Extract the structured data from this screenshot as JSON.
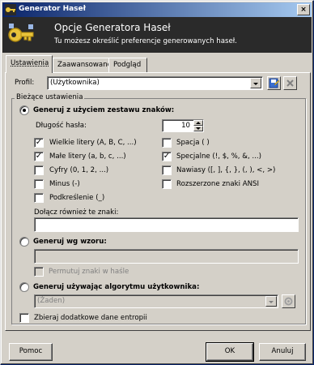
{
  "window": {
    "title": "Generator Haseł",
    "close_glyph": "×"
  },
  "header": {
    "title": "Opcje Generatora Haseł",
    "subtitle": "Tu możesz określić preferencje generowanych haseł.",
    "icon": "key-icon"
  },
  "tabs": [
    {
      "label": "Ustawienia",
      "active": true
    },
    {
      "label": "Zaawansowane",
      "active": false
    },
    {
      "label": "Podgląd",
      "active": false
    }
  ],
  "profile": {
    "label": "Profil:",
    "value": "(Użytkownika)"
  },
  "current_settings": {
    "group_label": "Bieżące ustawienia",
    "charset_mode": {
      "label": "Generuj z użyciem zestawu znaków:",
      "selected": true
    },
    "length": {
      "label": "Długość hasła:",
      "value": "10"
    },
    "options_left": [
      {
        "label": "Wielkie litery (A, B, C, ...)",
        "checked": true
      },
      {
        "label": "Małe litery (a, b, c, ...)",
        "checked": true
      },
      {
        "label": "Cyfry (0, 1, 2, ...)",
        "checked": false
      },
      {
        "label": "Minus (-)",
        "checked": false
      },
      {
        "label": "Podkreślenie (_)",
        "checked": false
      }
    ],
    "options_right": [
      {
        "label": "Spacja ( )",
        "checked": false
      },
      {
        "label": "Specjalne (!, $, %, &, ...)",
        "checked": true
      },
      {
        "label": "Nawiasy ([, ], {, }, (, ), <, >)",
        "checked": false
      },
      {
        "label": "Rozszerzone znaki ANSI",
        "checked": false
      }
    ],
    "extra_chars": {
      "label": "Dołącz również te znaki:",
      "value": ""
    },
    "pattern_mode": {
      "label": "Generuj wg wzoru:",
      "selected": false,
      "value": "",
      "permute_label": "Permutuj znaki w haśle",
      "permute_checked": false
    },
    "algorithm_mode": {
      "label": "Generuj używając algorytmu użytkownika:",
      "selected": false,
      "value": "(Żaden)"
    },
    "entropy": {
      "label": "Zbieraj dodatkowe dane entropii",
      "checked": false
    }
  },
  "buttons": {
    "help": "Pomoc",
    "ok": "OK",
    "cancel": "Anuluj"
  }
}
